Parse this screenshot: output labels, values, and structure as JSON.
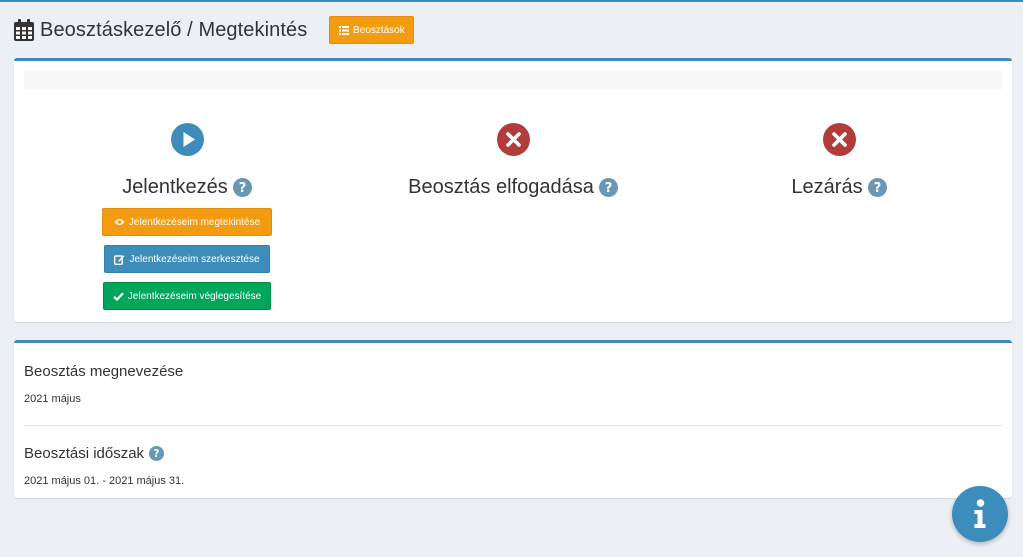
{
  "header": {
    "title": "Beosztáskezelő / Megtekintés",
    "icon": "calendar-icon",
    "list_button_label": "Beosztások"
  },
  "steps": [
    {
      "title": "Jelentkezés",
      "status": "play",
      "buttons": [
        {
          "label": "Jelentkezéseim megtekintése",
          "icon": "eye-icon"
        },
        {
          "label": "Jelentkezéseim szerkesztése",
          "icon": "edit-icon"
        },
        {
          "label": "Jelentkezéseim véglegesítése",
          "icon": "check-icon"
        }
      ]
    },
    {
      "title": "Beosztás elfogadása",
      "status": "closed"
    },
    {
      "title": "Lezárás",
      "status": "closed"
    }
  ],
  "details": {
    "name_label": "Beosztás megnevezése",
    "name_value": "2021 május",
    "period_label": "Beosztási időszak",
    "period_value": "2021 május 01. - 2021 május 31."
  },
  "colors": {
    "primary": "#3c8dbc",
    "warning": "#f39c12",
    "success": "#00a65a",
    "danger": "#b23b3b",
    "help": "#6a97b3",
    "background": "#ecf0f5"
  }
}
